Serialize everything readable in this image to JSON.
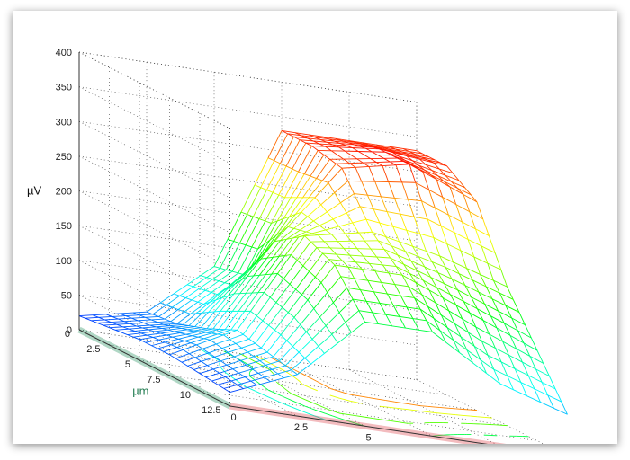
{
  "chart_data": {
    "type": "surface-mesh-with-contour",
    "zlabel": "µV",
    "xlabel": "µm",
    "ylabel": "µm",
    "x_ticks": [
      "0",
      "2.5",
      "5",
      "7.5",
      "10",
      "12.5"
    ],
    "y_ticks": [
      "0",
      "2.5",
      "5",
      "7.5",
      "10",
      "12.5"
    ],
    "z_ticks": [
      "0",
      "50",
      "100",
      "150",
      "200",
      "250",
      "300",
      "350",
      "400"
    ],
    "xlim": [
      0,
      12.5
    ],
    "ylim": [
      0,
      12.5
    ],
    "zlim": [
      0,
      400
    ],
    "grid": true,
    "colormap": [
      "#0000ff",
      "#00ffff",
      "#00ff00",
      "#ffff00",
      "#ff0000"
    ],
    "x_values": [
      0,
      2.5,
      5,
      7.5,
      10,
      12.5
    ],
    "y_values": [
      0,
      2.5,
      5,
      7.5,
      10,
      12.5
    ],
    "z_values": [
      [
        20,
        40,
        120,
        330,
        330,
        330
      ],
      [
        25,
        45,
        130,
        330,
        340,
        330
      ],
      [
        30,
        60,
        200,
        320,
        340,
        300
      ],
      [
        30,
        80,
        230,
        250,
        230,
        200
      ],
      [
        25,
        70,
        210,
        210,
        170,
        130
      ],
      [
        20,
        60,
        150,
        150,
        90,
        60
      ]
    ],
    "contour_levels": [
      100,
      150,
      200,
      250,
      300
    ]
  }
}
